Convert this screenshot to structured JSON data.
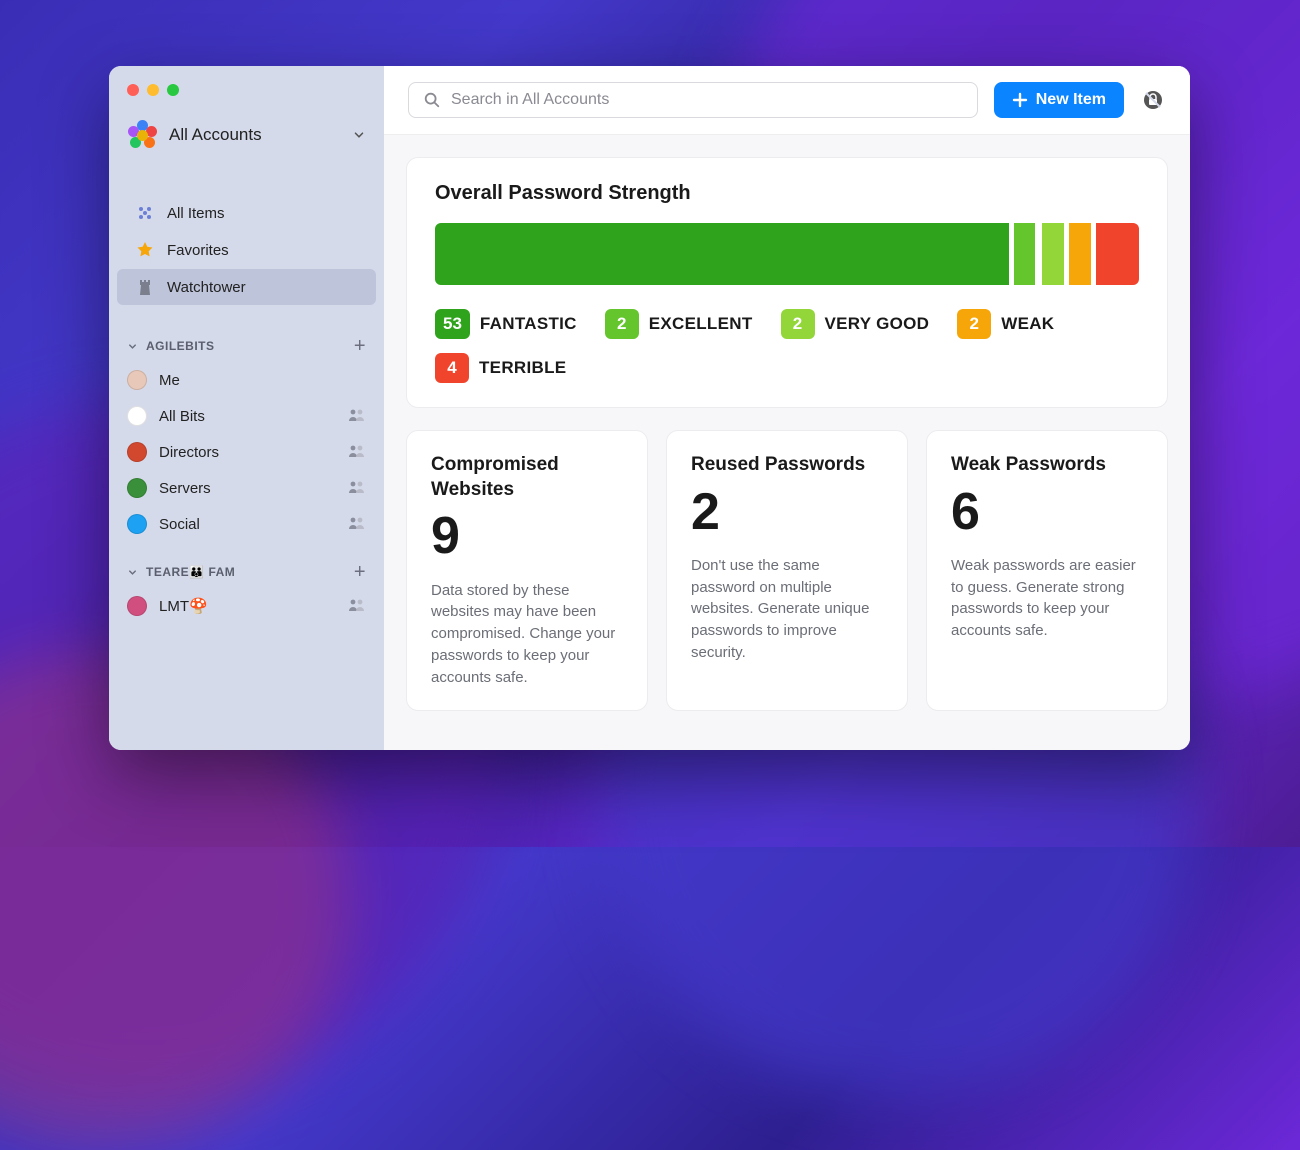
{
  "account_selector": {
    "title": "All Accounts"
  },
  "nav": {
    "items": [
      {
        "id": "all-items",
        "label": "All Items"
      },
      {
        "id": "favorites",
        "label": "Favorites"
      },
      {
        "id": "watchtower",
        "label": "Watchtower"
      }
    ]
  },
  "groups": [
    {
      "id": "agilebits",
      "label": "AGILEBITS",
      "vaults": [
        {
          "id": "me",
          "label": "Me",
          "shared": false,
          "color": "#e8c8b8"
        },
        {
          "id": "allbits",
          "label": "All Bits",
          "shared": true,
          "color": "#ffffff"
        },
        {
          "id": "directors",
          "label": "Directors",
          "shared": true,
          "color": "#d1482f"
        },
        {
          "id": "servers",
          "label": "Servers",
          "shared": true,
          "color": "#3a8f3a"
        },
        {
          "id": "social",
          "label": "Social",
          "shared": true,
          "color": "#1da1f2"
        }
      ]
    },
    {
      "id": "teare-fam",
      "label": "TEARE👪 FAM",
      "vaults": [
        {
          "id": "lmt",
          "label": "LMT🍄",
          "shared": true,
          "color": "#d14f7f"
        }
      ]
    }
  ],
  "search": {
    "placeholder": "Search in All Accounts"
  },
  "new_item": {
    "label": "New Item"
  },
  "strength_card": {
    "title": "Overall Password Strength",
    "legend": [
      {
        "count": "53",
        "label": "FANTASTIC",
        "color": "#2fa31b"
      },
      {
        "count": "2",
        "label": "EXCELLENT",
        "color": "#64c52c"
      },
      {
        "count": "2",
        "label": "VERY GOOD",
        "color": "#92d63a"
      },
      {
        "count": "2",
        "label": "WEAK",
        "color": "#f6a609"
      },
      {
        "count": "4",
        "label": "TERRIBLE",
        "color": "#f0452c"
      }
    ]
  },
  "stat_cards": [
    {
      "id": "compromised",
      "title": "Compromised Websites",
      "value": "9",
      "description": "Data stored by these websites may have been compromised. Change your passwords to keep your accounts safe."
    },
    {
      "id": "reused",
      "title": "Reused Passwords",
      "value": "2",
      "description": "Don't use the same password on multiple websites. Generate unique passwords to improve security."
    },
    {
      "id": "weak",
      "title": "Weak Passwords",
      "value": "6",
      "description": "Weak passwords are easier to guess. Generate strong passwords to keep your accounts safe."
    }
  ],
  "chart_data": {
    "type": "bar",
    "title": "Overall Password Strength",
    "categories": [
      "FANTASTIC",
      "EXCELLENT",
      "VERY GOOD",
      "WEAK",
      "TERRIBLE"
    ],
    "values": [
      53,
      2,
      2,
      2,
      4
    ],
    "colors": [
      "#2fa31b",
      "#64c52c",
      "#92d63a",
      "#f6a609",
      "#f0452c"
    ]
  }
}
